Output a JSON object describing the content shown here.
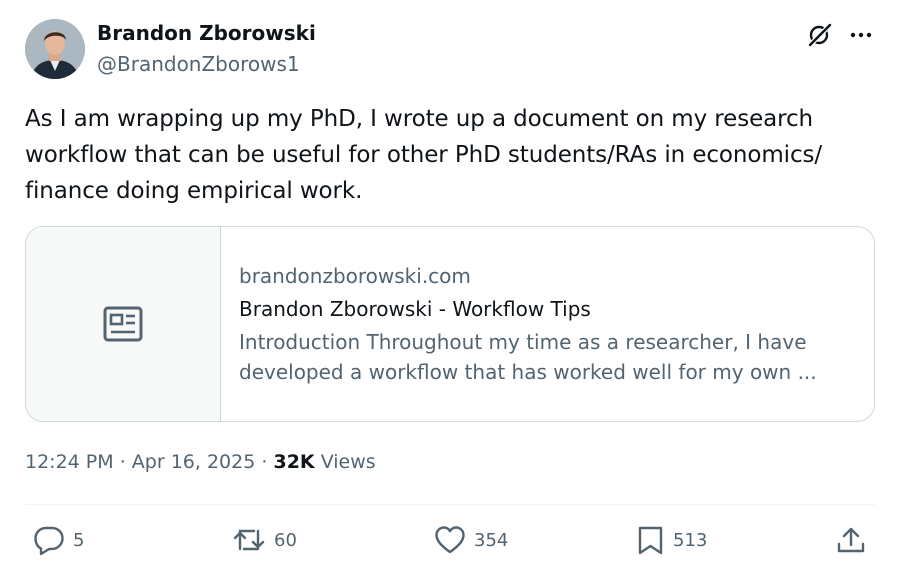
{
  "author": {
    "display_name": "Brandon Zborowski",
    "handle": "@BrandonZborows1"
  },
  "tweet": {
    "text": "As I am wrapping up my PhD, I wrote up a document on my research workflow that can be useful for other PhD students/RAs in economics/ finance doing empirical work."
  },
  "card": {
    "domain": "brandonzborowski.com",
    "title": "Brandon Zborowski - Workflow Tips",
    "description": "Introduction Throughout my time as a researcher, I have developed a workflow that has worked well for my own ..."
  },
  "meta": {
    "time": "12:24 PM",
    "separator": "·",
    "date": "Apr 16, 2025",
    "views_count": "32K",
    "views_label": "Views"
  },
  "actions": {
    "replies": "5",
    "reposts": "60",
    "likes": "354",
    "bookmarks": "513"
  },
  "icons": {
    "header": [
      "grok-icon",
      "more-icon"
    ],
    "card": "newspaper-icon",
    "actions": [
      "reply-icon",
      "repost-icon",
      "like-icon",
      "bookmark-icon",
      "share-icon"
    ]
  },
  "colors": {
    "text_primary": "#0f1419",
    "text_secondary": "#536471",
    "border": "#cfd9de",
    "card_thumb_bg": "#f7f9f9"
  }
}
